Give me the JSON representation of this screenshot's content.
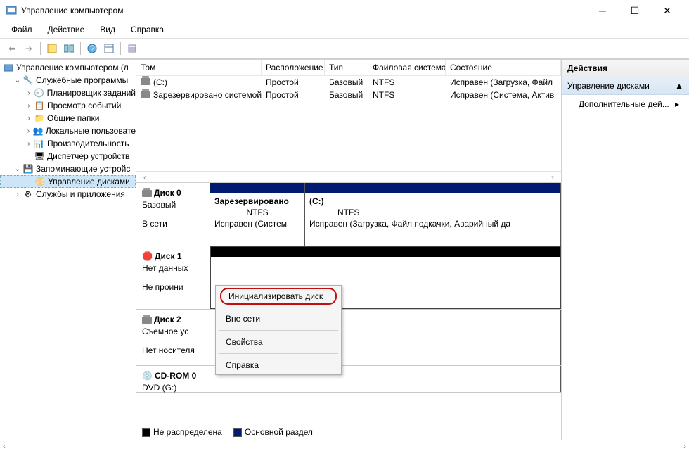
{
  "window": {
    "title": "Управление компьютером"
  },
  "menu": [
    "Файл",
    "Действие",
    "Вид",
    "Справка"
  ],
  "tree": {
    "root": "Управление компьютером (л",
    "system_tools": "Служебные программы",
    "task_scheduler": "Планировщик заданий",
    "event_viewer": "Просмотр событий",
    "shared_folders": "Общие папки",
    "local_users": "Локальные пользовате",
    "performance": "Производительность",
    "device_manager": "Диспетчер устройств",
    "storage": "Запоминающие устройс",
    "disk_mgmt": "Управление дисками",
    "services": "Службы и приложения"
  },
  "columns": {
    "tom": "Том",
    "loc": "Расположение",
    "type": "Тип",
    "fs": "Файловая система",
    "state": "Состояние"
  },
  "volumes": [
    {
      "tom": "(C:)",
      "loc": "Простой",
      "type": "Базовый",
      "fs": "NTFS",
      "state": "Исправен (Загрузка, Файл"
    },
    {
      "tom": "Зарезервировано системой",
      "loc": "Простой",
      "type": "Базовый",
      "fs": "NTFS",
      "state": "Исправен (Система, Актив"
    }
  ],
  "disks": {
    "d0": {
      "name": "Диск 0",
      "type": "Базовый",
      "status": "В сети"
    },
    "d0p1": {
      "title": "Зарезервировано",
      "fs": "NTFS",
      "state": "Исправен (Систем"
    },
    "d0p2": {
      "title": "(C:)",
      "fs": "NTFS",
      "state": "Исправен (Загрузка, Файл подкачки, Аварийный да"
    },
    "d1": {
      "name": "Диск 1",
      "type": "Нет данных",
      "status": "Не проини"
    },
    "d2": {
      "name": "Диск 2",
      "type": "Съемное ус",
      "status": "Нет носителя"
    },
    "cd": {
      "name": "CD-ROM 0",
      "type": "DVD (G:)"
    }
  },
  "context_menu": {
    "initialize": "Инициализировать диск",
    "offline": "Вне сети",
    "properties": "Свойства",
    "help": "Справка"
  },
  "legend": {
    "unallocated": "Не распределена",
    "primary": "Основной раздел"
  },
  "actions": {
    "header": "Действия",
    "disk_mgmt": "Управление дисками",
    "more": "Дополнительные дей...",
    "caret": "▲",
    "arrow": "▸"
  }
}
